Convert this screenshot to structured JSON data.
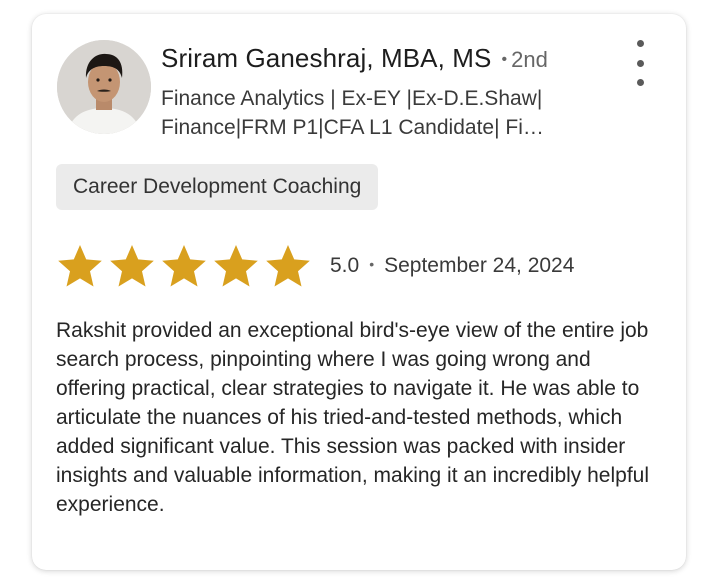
{
  "reviewer": {
    "name": "Sriram Ganeshraj, MBA, MS",
    "connection_degree": "2nd",
    "headline": "Finance Analytics | Ex-EY |Ex-D.E.Shaw| Finance|FRM P1|CFA L1 Candidate| Fi…"
  },
  "service_tag": "Career Development Coaching",
  "rating": {
    "score": "5.0",
    "stars_filled": 5,
    "stars_total": 5,
    "date": "September 24, 2024",
    "star_color": "#D9A01E"
  },
  "review_text": "Rakshit provided an exceptional bird's-eye view of the entire job search process, pinpointing where I was going wrong and offering practical, clear strategies to navigate it. He was able to articulate the nuances of his tried-and-tested methods, which added significant value. This session was packed with insider insights and valuable information, making it an incredibly helpful experience.",
  "icons": {
    "menu": "more-vertical-icon",
    "star": "star-icon"
  }
}
